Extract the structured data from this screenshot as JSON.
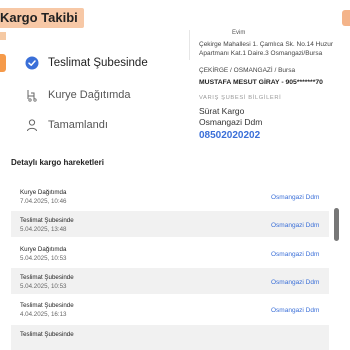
{
  "header": {
    "title": "Kargo Takibi"
  },
  "steps": [
    {
      "label": "Teslimat Şubesinde",
      "icon": "check-circle-icon",
      "state": "done"
    },
    {
      "label": "Kurye Dağıtımda",
      "icon": "courier-icon",
      "state": "pending"
    },
    {
      "label": "Tamamlandı",
      "icon": "person-icon",
      "state": "pending"
    }
  ],
  "recipient": {
    "top_text": "Evim",
    "address": "Çekirge Mahallesi 1. Çamlıca Sk. No.14 Huzur Apartmanı Kat.1 Daire.3 Osmangazi/Bursa",
    "city": "ÇEKİRGE / OSMANGAZİ / Bursa",
    "name_phone": "MUSTAFA MESUT GİRAY - 905*******70"
  },
  "branch": {
    "section_title": "VARIŞ ŞUBESİ BİLGİLERİ",
    "company": "Sürat Kargo",
    "name": "Osmangazi Ddm",
    "phone": "08502020202"
  },
  "movements": {
    "title": "Detaylı kargo hareketleri",
    "rows": [
      {
        "status": "Kurye Dağıtımda",
        "date": "7.04.2025, 10:46",
        "branch": "Osmangazi Ddm"
      },
      {
        "status": "Teslimat Şubesinde",
        "date": "5.04.2025, 13:48",
        "branch": "Osmangazi Ddm"
      },
      {
        "status": "Kurye Dağıtımda",
        "date": "5.04.2025, 10:53",
        "branch": "Osmangazi Ddm"
      },
      {
        "status": "Teslimat Şubesinde",
        "date": "5.04.2025, 10:53",
        "branch": "Osmangazi Ddm"
      },
      {
        "status": "Teslimat Şubesinde",
        "date": "4.04.2025, 16:13",
        "branch": "Osmangazi Ddm"
      },
      {
        "status": "Teslimat Şubesinde",
        "date": "",
        "branch": ""
      }
    ]
  },
  "colors": {
    "accent": "#f59a4a",
    "highlight": "#f7c8a6",
    "link": "#3a6fd8"
  }
}
